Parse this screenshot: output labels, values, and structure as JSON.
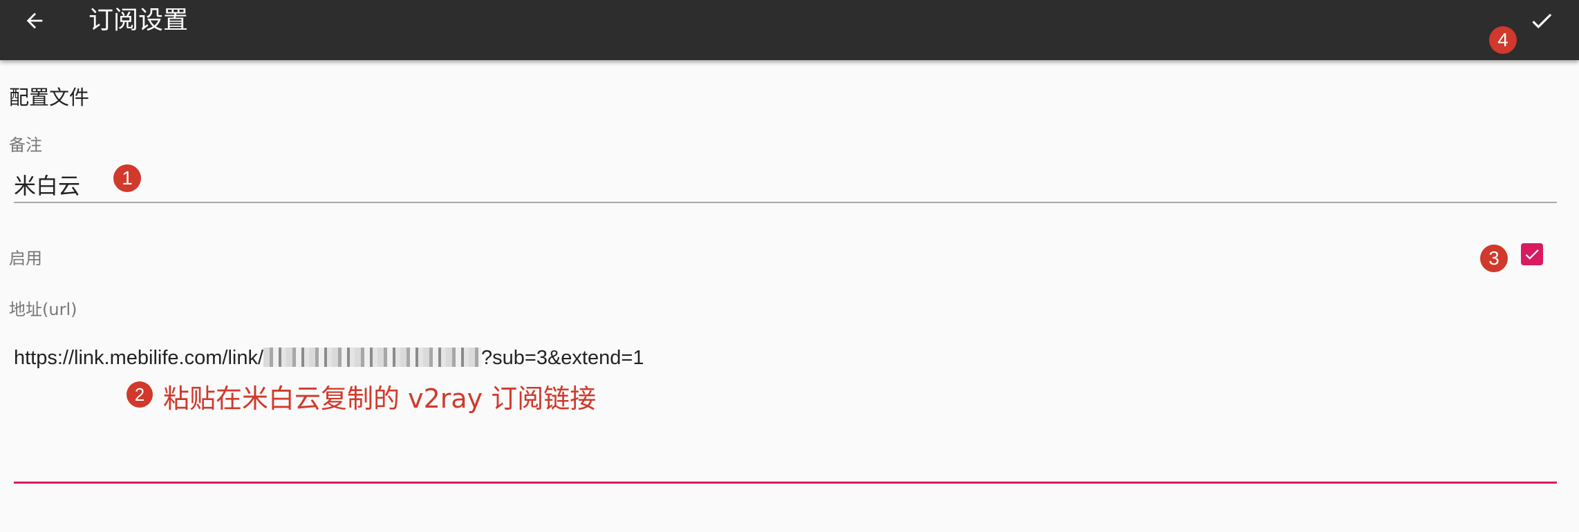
{
  "app_bar": {
    "title": "订阅设置",
    "back_icon": "arrow-left-icon",
    "confirm_icon": "check-icon",
    "background_color": "#2d2d2d"
  },
  "form": {
    "section_title": "配置文件",
    "remark": {
      "label": "备注",
      "value": "米白云"
    },
    "enabled": {
      "label": "启用",
      "checked": true,
      "accent_color": "#d81b60"
    },
    "url": {
      "label": "地址(url)",
      "value_prefix": "https://link.mebilife.com/link/",
      "value_suffix": "?sub=3&extend=1"
    }
  },
  "annotations": {
    "badge_1": "1",
    "badge_2": "2",
    "badge_3": "3",
    "badge_4": "4",
    "paste_hint": "粘贴在米白云复制的 v2ray 订阅链接",
    "badge_color": "#d0392b"
  }
}
